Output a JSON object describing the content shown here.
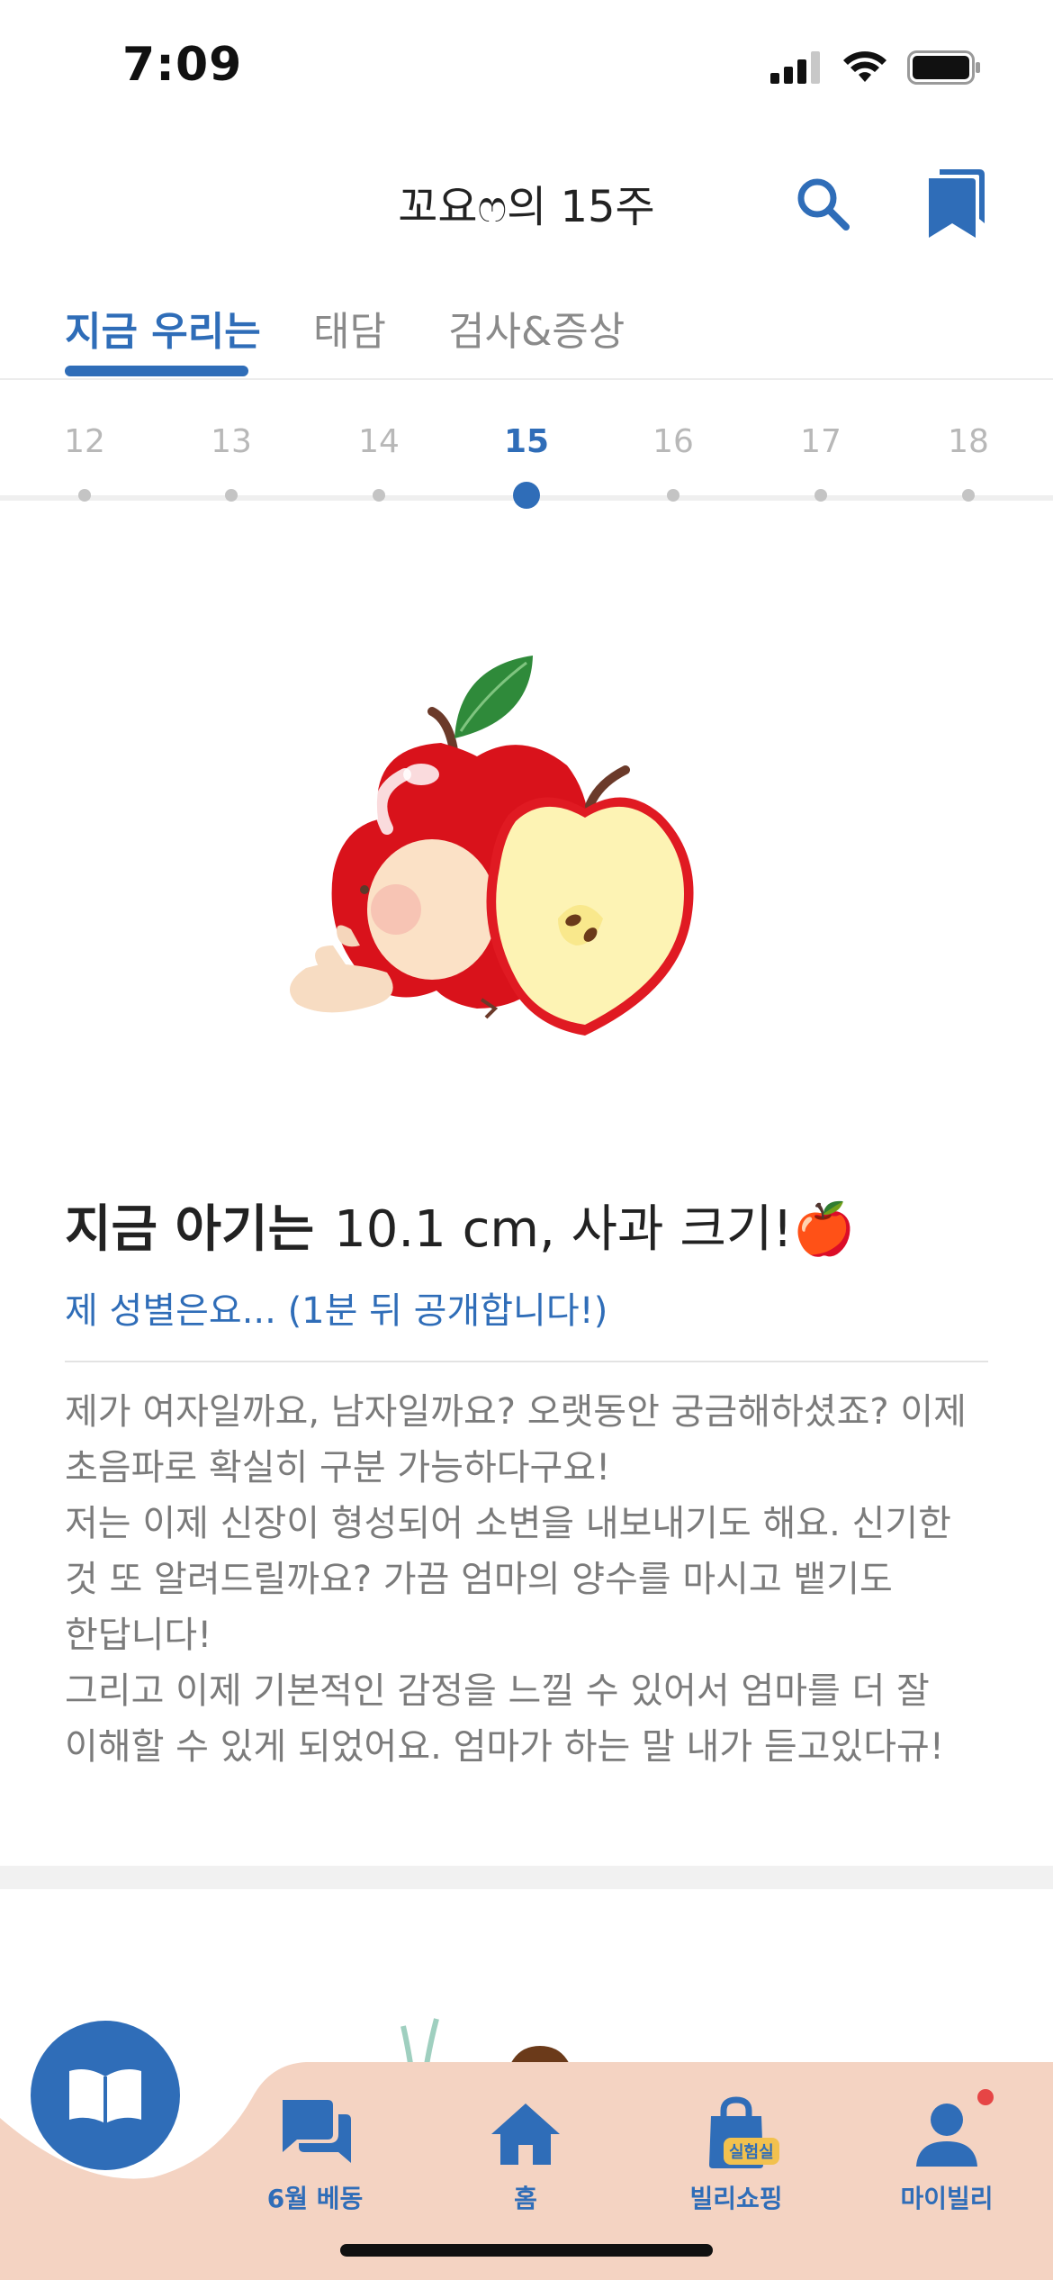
{
  "status_bar": {
    "time": "7:09"
  },
  "header": {
    "title": "꼬요ෆ의 15주"
  },
  "tabs": [
    {
      "label": "지금 우리는",
      "active": true
    },
    {
      "label": "태담",
      "active": false
    },
    {
      "label": "검사&증상",
      "active": false
    }
  ],
  "weeks": {
    "items": [
      "12",
      "13",
      "14",
      "15",
      "16",
      "17",
      "18"
    ],
    "selected": "15"
  },
  "content": {
    "headline_lead": "지금 아기는",
    "headline_rest": "10.1 cm, 사과 크기!🍎",
    "sub_link": "제 성별은요... (1분 뒤 공개합니다!)",
    "paragraphs": [
      "제가 여자일까요, 남자일까요? 오랫동안 궁금해하셨죠? 이제 초음파로 확실히 구분 가능하다구요!",
      "저는 이제 신장이 형성되어 소변을 내보내기도 해요. 신기한 것 또 알려드릴까요? 가끔 엄마의 양수를 마시고 뱉기도 한답니다!",
      "그리고 이제 기본적인 감정을 느낄 수 있어서 엄마를 더 잘 이해할 수 있게 되었어요. 엄마가 하는 말 내가 듣고있다규!"
    ]
  },
  "bottom_nav": {
    "items": [
      {
        "label": "6월 베동",
        "icon": "chat-bubbles-icon"
      },
      {
        "label": "홈",
        "icon": "home-icon"
      },
      {
        "label": "빌리쇼핑",
        "icon": "shopping-bag-icon",
        "badge": "실험실"
      },
      {
        "label": "마이빌리",
        "icon": "person-icon",
        "notification": true
      }
    ]
  },
  "colors": {
    "accent": "#2f6db8",
    "nav_background": "#f4d3c2",
    "body_text": "#7b7b7b",
    "badge": "#e64545"
  }
}
